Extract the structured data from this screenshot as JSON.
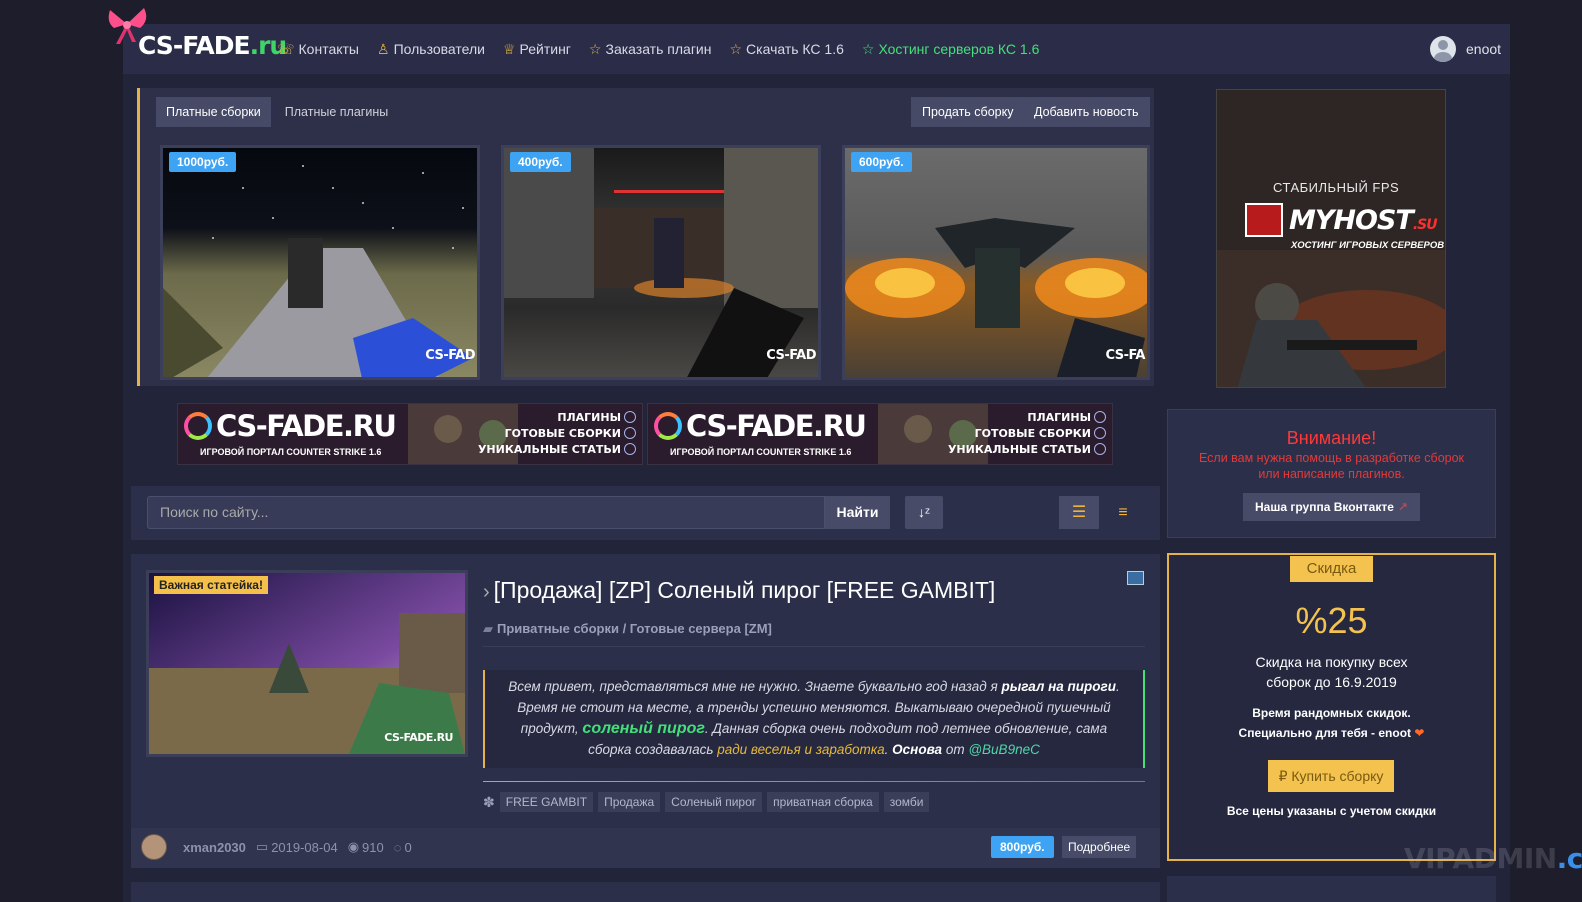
{
  "header": {
    "logo_main": "CS-FADE",
    "logo_suffix": ".ru",
    "nav": [
      {
        "label": "Контакты",
        "icon": "phone-icon",
        "glyph": "☏"
      },
      {
        "label": "Пользователи",
        "icon": "users-icon",
        "glyph": "♙"
      },
      {
        "label": "Рейтинг",
        "icon": "trophy-icon",
        "glyph": "♕"
      },
      {
        "label": "Заказать плагин",
        "icon": "star-icon",
        "glyph": "☆"
      },
      {
        "label": "Скачать КС 1.6",
        "icon": "star-icon",
        "glyph": "☆"
      },
      {
        "label": "Хостинг серверов КС 1.6",
        "icon": "star-icon",
        "glyph": "☆"
      }
    ],
    "username": "enoot"
  },
  "slider": {
    "tabs": [
      "Платные сборки",
      "Платные плагины"
    ],
    "sell_button": "Продать сборку",
    "add_news_button": "Добавить новость",
    "items": [
      {
        "price": "1000руб.",
        "mark": "CS-FAD"
      },
      {
        "price": "400руб.",
        "mark": "CS-FAD"
      },
      {
        "price": "600руб.",
        "mark": "CS-FA"
      }
    ]
  },
  "side_banner": {
    "top_text": "СТАБИЛЬНЫЙ FPS",
    "brand_a": "MYHOST",
    "brand_b": ".SU",
    "subtitle": "ХОСТИНГ ИГРОВЫХ СЕРВЕРОВ"
  },
  "ads": [
    {
      "title": "CS-FADE.RU",
      "sub": "ИГРОВОЙ ПОРТАЛ COUNTER STRIKE 1.6",
      "list": [
        "ПЛАГИНЫ",
        "ГОТОВЫЕ СБОРКИ",
        "УНИКАЛЬНЫЕ СТАТЬИ"
      ]
    },
    {
      "title": "CS-FADE.RU",
      "sub": "ИГРОВОЙ ПОРТАЛ COUNTER STRIKE 1.6",
      "list": [
        "ПЛАГИНЫ",
        "ГОТОВЫЕ СБОРКИ",
        "УНИКАЛЬНЫЕ СТАТЬИ"
      ]
    }
  ],
  "search": {
    "placeholder": "Поиск по сайту...",
    "button": "Найти"
  },
  "article": {
    "badge": "Важная статейка!",
    "title": "[Продажа] [ZP] Соленый пирог [FREE GAMBIT]",
    "category": "Приватные сборки / Готовые сервера [ZM]",
    "quote": {
      "p1": "Всем привет, представляться мне не нужно. Знаете буквально год назад я ",
      "b1": "рыгал на пироги",
      "p2": ". Время не стоит на месте, а тренды успешно меняются. Выкатываю очередной пушечный продукт, ",
      "g1": "соленый пирог",
      "p3": ". Данная сборка очень подходит под летнее обновление, сама сборка создавалась ",
      "y1": "ради веселья и заработка",
      "p4": ". ",
      "b2": "Основа",
      "p5": " от ",
      "l1": "@BuB9neC"
    },
    "tags": [
      "FREE GAMBIT",
      "Продажа",
      "Соленый пирог",
      "приватная сборка",
      "зомби"
    ],
    "author": "xman2030",
    "date": "2019-08-04",
    "views": "910",
    "comments": "0",
    "price": "800руб.",
    "more": "Подробнее",
    "thumb_mark": "CS-FADE.RU"
  },
  "attention": {
    "title": "Внимание!",
    "text": "Если вам нужна помощь в разработке сборок или написание плагинов.",
    "button": "Наша группа Вконтакте"
  },
  "promo": {
    "tab": "Скидка",
    "big": "%25",
    "desc1": "Скидка на покупку всех",
    "desc2": "сборок до 16.9.2019",
    "small1": "Время рандомных скидок.",
    "small2": "Специально для тебя - enoot",
    "buy": "₽ Купить сборку",
    "note": "Все цены указаны с учетом скидки"
  },
  "watermark": {
    "a": "VIPADMIN",
    "b": ".club"
  },
  "colors": {
    "accent": "#e3b34a",
    "green": "#43e07a",
    "blue": "#3ea3f2",
    "red": "#ff3838"
  }
}
